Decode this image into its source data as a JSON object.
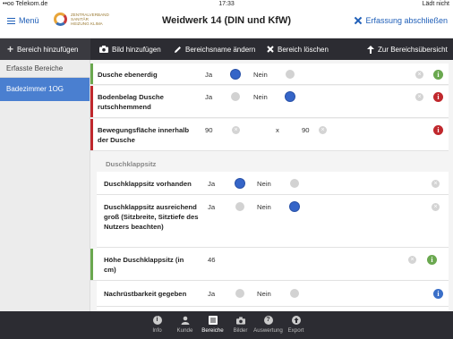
{
  "status": {
    "carrier": "••oo Telekom.de",
    "time": "17:33",
    "battery": "Lädt nicht"
  },
  "header": {
    "menu_label": "Menü",
    "logo_line1": "ZENTRALVERBAND",
    "logo_line2": "SANITÄR",
    "logo_line3": "HEIZUNG KLIMA",
    "title": "Weidwerk 14 (DIN und KfW)",
    "finish_label": "Erfassung abschließen"
  },
  "toolbar": {
    "add_area": "Bereich hinzufügen",
    "add_image": "Bild hinzufügen",
    "rename_area": "Bereichsname ändern",
    "delete_area": "Bereich löschen",
    "overview": "Zur Bereichsübersicht"
  },
  "sidebar": {
    "header": "Erfasste Bereiche",
    "items": [
      {
        "label": "Badezimmer 1OG"
      }
    ]
  },
  "form": {
    "yes": "Ja",
    "no": "Nein",
    "x": "x",
    "rows": [
      {
        "label": "Dusche ebenerdig",
        "selected": "yes",
        "status": "green"
      },
      {
        "label": "Bodenbelag Dusche rutschhemmend",
        "selected": "no",
        "status": "red"
      },
      {
        "label": "Bewegungsfläche innerhalb der Dusche",
        "width": "90",
        "depth": "90",
        "status": "red"
      }
    ],
    "section_title": "Duschklappsitz",
    "section_rows": [
      {
        "label": "Duschklappsitz vorhanden",
        "selected": "yes",
        "status": "none"
      },
      {
        "label": "Duschklappsitz ausreichend groß (Sitzbreite, Sitztiefe des Nutzers beachten)",
        "selected": "no",
        "status": "none"
      },
      {
        "label": "Höhe Duschklappsitz (in cm)",
        "value": "46",
        "status": "green"
      },
      {
        "label": "Nachrüstbarkeit gegeben",
        "selected": "none",
        "status": "blue"
      }
    ]
  },
  "tabs": [
    {
      "label": "Info",
      "icon": "info-icon"
    },
    {
      "label": "Kunde",
      "icon": "person-icon"
    },
    {
      "label": "Bereiche",
      "icon": "list-icon",
      "active": true
    },
    {
      "label": "Bilder",
      "icon": "camera-icon"
    },
    {
      "label": "Auswertung",
      "icon": "question-icon"
    },
    {
      "label": "Export",
      "icon": "export-icon"
    }
  ],
  "colors": {
    "green": "#6aa84f",
    "red": "#c0282d",
    "blue": "#3a6fc8",
    "accent": "#1f5fb8"
  }
}
